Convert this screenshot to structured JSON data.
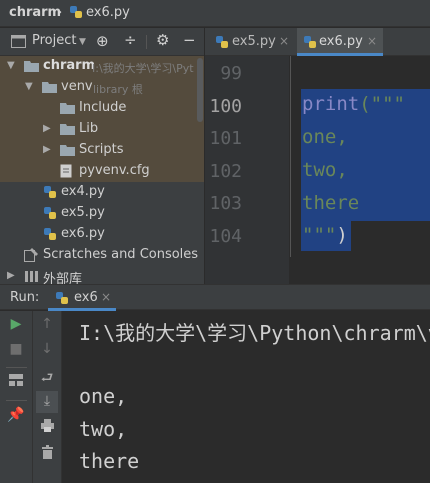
{
  "breadcrumb": {
    "project": "chrarm",
    "file": "ex6.py"
  },
  "project_toolbar": {
    "label": "Project"
  },
  "editor_tabs": [
    {
      "label": "ex5.py",
      "close": "×"
    },
    {
      "label": "ex6.py",
      "close": "×"
    }
  ],
  "tree": {
    "root": {
      "name": "chrarm",
      "path": "I:\\我的大学\\学习\\Pyt"
    },
    "venv": {
      "name": "venv",
      "note": "library 根"
    },
    "folders": [
      "Include",
      "Lib",
      "Scripts"
    ],
    "venv_file": "pyvenv.cfg",
    "files": [
      "ex4.py",
      "ex5.py",
      "ex6.py"
    ],
    "scratches": "Scratches and Consoles",
    "external": "外部库"
  },
  "editor": {
    "line_numbers": [
      "99",
      "100",
      "101",
      "102",
      "103",
      "104"
    ],
    "current_line": "100",
    "code": {
      "print_kw": "print",
      "open_paren_quote": "(\"\"\"",
      "line101": "one,",
      "line102": "two,",
      "line103": "there",
      "close_quote": "\"\"\"",
      "close_paren": ")"
    }
  },
  "run": {
    "label": "Run:",
    "config": "ex6",
    "close": "×",
    "output": [
      "I:\\我的大学\\学习\\Python\\chrarm\\v",
      "",
      "one,",
      "two,",
      "there"
    ]
  },
  "colors": {
    "selection": "#214283",
    "keyword_print": "#8888c6",
    "string": "#6a8759",
    "tab_underline": "#4a88c7",
    "run_icon": "#59a869",
    "python_icon_blue": "#3d7ab8",
    "python_icon_yellow": "#e0c14a"
  }
}
